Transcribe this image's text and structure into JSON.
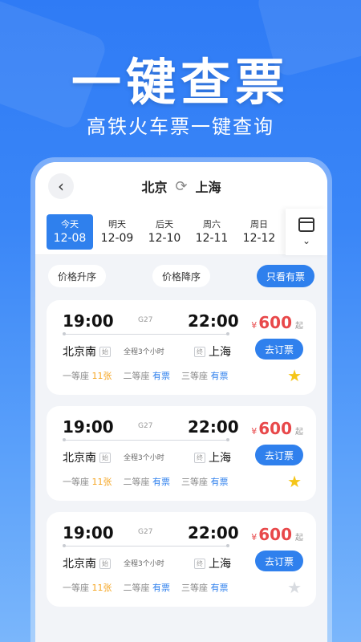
{
  "hero": {
    "title": "一键查票",
    "subtitle": "高铁火车票一键查询"
  },
  "header": {
    "back_icon": "‹",
    "from": "北京",
    "to": "上海",
    "swap_icon": "⟳"
  },
  "dates": [
    {
      "name": "今天",
      "value": "12-08",
      "active": true
    },
    {
      "name": "明天",
      "value": "12-09"
    },
    {
      "name": "后天",
      "value": "12-10"
    },
    {
      "name": "周六",
      "value": "12-11"
    },
    {
      "name": "周日",
      "value": "12-12"
    }
  ],
  "calendar": {
    "chevron": "⌄"
  },
  "filters": {
    "asc": "价格升序",
    "desc": "价格降序",
    "available": "只看有票"
  },
  "trains": [
    {
      "dep_time": "19:00",
      "arr_time": "22:00",
      "train_no": "G27",
      "dep_station": "北京南",
      "dep_tag": "始",
      "arr_station": "上海",
      "arr_tag": "终",
      "duration": "全程3个小时",
      "seat1": "一等座",
      "seat1_cnt": "11张",
      "seat2": "二等座",
      "seat2_cnt": "有票",
      "seat3": "三等座",
      "seat3_cnt": "有票",
      "currency": "¥",
      "price": "600",
      "price_suffix": "起",
      "book": "去订票",
      "starred": true
    },
    {
      "dep_time": "19:00",
      "arr_time": "22:00",
      "train_no": "G27",
      "dep_station": "北京南",
      "dep_tag": "始",
      "arr_station": "上海",
      "arr_tag": "终",
      "duration": "全程3个小时",
      "seat1": "一等座",
      "seat1_cnt": "11张",
      "seat2": "二等座",
      "seat2_cnt": "有票",
      "seat3": "三等座",
      "seat3_cnt": "有票",
      "currency": "¥",
      "price": "600",
      "price_suffix": "起",
      "book": "去订票",
      "starred": true
    },
    {
      "dep_time": "19:00",
      "arr_time": "22:00",
      "train_no": "G27",
      "dep_station": "北京南",
      "dep_tag": "始",
      "arr_station": "上海",
      "arr_tag": "终",
      "duration": "全程3个小时",
      "seat1": "一等座",
      "seat1_cnt": "11张",
      "seat2": "二等座",
      "seat2_cnt": "有票",
      "seat3": "三等座",
      "seat3_cnt": "有票",
      "currency": "¥",
      "price": "600",
      "price_suffix": "起",
      "book": "去订票",
      "starred": false
    }
  ],
  "icons": {
    "star": "★"
  },
  "colors": {
    "accent": "#2f80ed",
    "price": "#e8484a",
    "star": "#f5c518"
  }
}
